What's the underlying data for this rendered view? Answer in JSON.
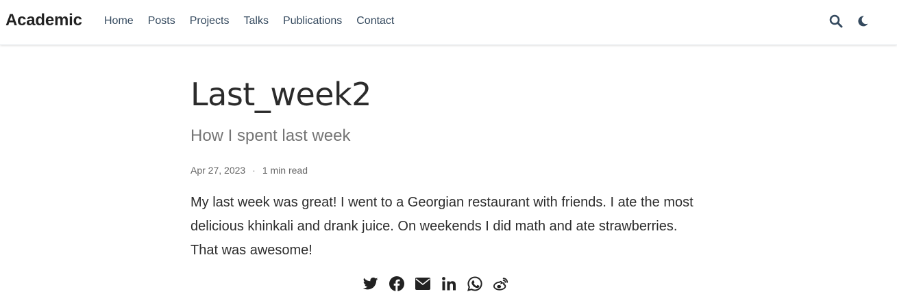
{
  "navbar": {
    "brand": "Academic",
    "links": [
      "Home",
      "Posts",
      "Projects",
      "Talks",
      "Publications",
      "Contact"
    ],
    "icons": [
      "search-icon",
      "moon-icon"
    ]
  },
  "article": {
    "title": "Last_week2",
    "subtitle": "How I spent last week",
    "date": "Apr 27, 2023",
    "separator": "·",
    "reading_time": "1 min read",
    "body": "My last week was great! I went to a Georgian restaurant with friends. I ate the most delicious khinkali and drank juice. On weekends I did math and ate strawberries. That was awesome!"
  },
  "share": {
    "icons": [
      "twitter-icon",
      "facebook-icon",
      "email-icon",
      "linkedin-icon",
      "whatsapp-icon",
      "weibo-icon"
    ]
  },
  "colors": {
    "nav_link": "#34495e",
    "icon": "#34495e",
    "share_icon": "#222222"
  }
}
